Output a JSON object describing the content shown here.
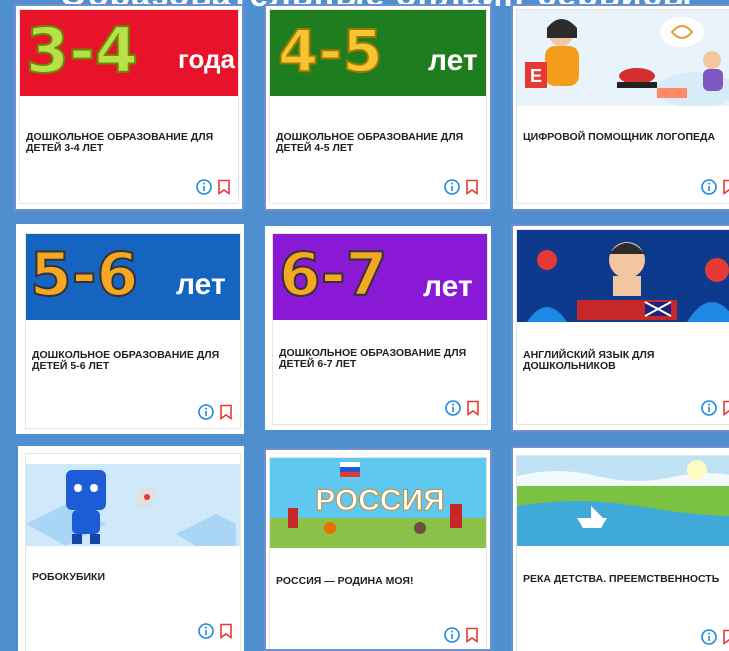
{
  "header": {
    "title": "Образовательные онлайн-сервисы"
  },
  "colors": {
    "background": "#4f8fd0",
    "red": "#e8122b",
    "green": "#1e7d1e",
    "blue": "#1565c0",
    "purple": "#8a19d6",
    "icon_blue": "#1e88e5",
    "icon_red": "#e53935"
  },
  "cards": [
    {
      "title": "ДОШКОЛЬНОЕ ОБРАЗОВАНИЕ ДЛЯ ДЕТЕЙ 3-4 ЛЕТ",
      "banner_num": "3-4",
      "banner_word": "года"
    },
    {
      "title": "ДОШКОЛЬНОЕ ОБРАЗОВАНИЕ ДЛЯ ДЕТЕЙ 4-5 ЛЕТ",
      "banner_num": "4-5",
      "banner_word": "лет"
    },
    {
      "title": "ЦИФРОВОЙ ПОМОЩНИК ЛОГОПЕДА",
      "banner_letter": "E"
    },
    {
      "title": "ДОШКОЛЬНОЕ ОБРАЗОВАНИЕ ДЛЯ ДЕТЕЙ 5-6 ЛЕТ",
      "banner_num": "5-6",
      "banner_word": "лет"
    },
    {
      "title": "ДОШКОЛЬНОЕ ОБРАЗОВАНИЕ ДЛЯ ДЕТЕЙ 6-7 ЛЕТ",
      "banner_num": "6-7",
      "banner_word": "лет"
    },
    {
      "title": "АНГЛИЙСКИЙ ЯЗЫК ДЛЯ ДОШКОЛЬНИКОВ"
    },
    {
      "title": "РОБОКУБИКИ"
    },
    {
      "title": "РОССИЯ — РОДИНА МОЯ!",
      "banner_text": "РОССИЯ"
    },
    {
      "title": "РЕКА ДЕТСТВА. ПРЕЕМСТВЕННОСТЬ"
    }
  ],
  "icons": {
    "info": "info-icon",
    "bookmark": "bookmark-icon"
  }
}
